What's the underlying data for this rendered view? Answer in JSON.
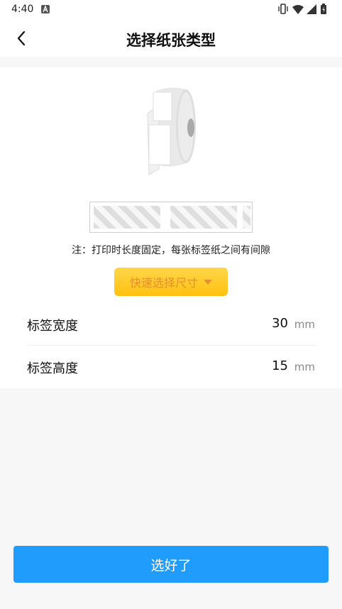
{
  "status_bar": {
    "time": "4:40",
    "icons": [
      "app-notification-icon",
      "vibrate-icon",
      "wifi-icon",
      "signal-icon",
      "battery-icon"
    ]
  },
  "nav": {
    "title": "选择纸张类型",
    "back_icon": "chevron-left-icon"
  },
  "illustration": {
    "roll_icon": "label-roll-icon",
    "strip_icon": "label-strip-icon"
  },
  "note": "注：打印时长度固定，每张标签纸之间有间隙",
  "quick_select": {
    "label": "快速选择尺寸",
    "icon": "triangle-down-icon"
  },
  "fields": {
    "width": {
      "label": "标签宽度",
      "value": "30",
      "unit": "mm"
    },
    "height": {
      "label": "标签高度",
      "value": "15",
      "unit": "mm"
    }
  },
  "confirm_button": "选好了",
  "colors": {
    "primary_blue": "#1f9cfc",
    "quick_select_yellow": "#ffc10f",
    "quick_select_text": "#e6902a",
    "background": "#f7f7f7"
  }
}
